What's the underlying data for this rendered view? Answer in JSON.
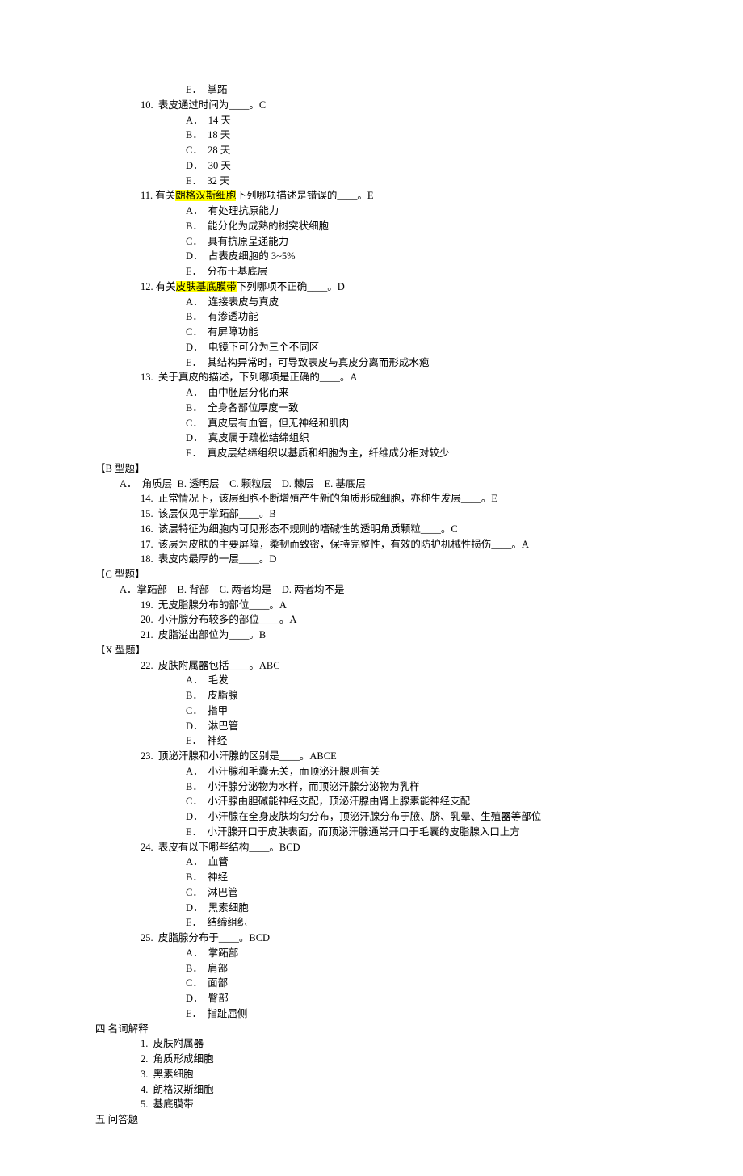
{
  "q9e": "E．  掌跖",
  "q10": "10.  表皮通过时间为____。C",
  "q10a": "A．  14 天",
  "q10b": "B．  18 天",
  "q10c": "C．  28 天",
  "q10d": "D．  30 天",
  "q10e": "E．  32 天",
  "q11_a": "11.  有关",
  "q11_hl": "朗格汉斯细胞",
  "q11_b": "下列哪项描述是错误的____。E",
  "q11a": "A．  有处理抗原能力",
  "q11b": "B．  能分化为成熟的树突状细胞",
  "q11c": "C．  具有抗原呈递能力",
  "q11d": "D．  占表皮细胞的 3~5%",
  "q11e": "E．  分布于基底层",
  "q12_a": "12.  有关",
  "q12_hl": "皮肤基底膜带",
  "q12_b": "下列哪项不正确____。D",
  "q12a": "A．  连接表皮与真皮",
  "q12b": "B．  有渗透功能",
  "q12c": "C．  有屏障功能",
  "q12d": "D．  电镜下可分为三个不同区",
  "q12e": "E．  其结构异常时，可导致表皮与真皮分离而形成水疱",
  "q13": "13.  关于真皮的描述，下列哪项是正确的____。A",
  "q13a": "A．  由中胚层分化而来",
  "q13b": "B．  全身各部位厚度一致",
  "q13c": "C．  真皮层有血管，但无神经和肌肉",
  "q13d": "D．  真皮属于疏松结缔组织",
  "q13e": "E．  真皮层结缔组织以基质和细胞为主，纤维成分相对较少",
  "secB": "【B 型题】",
  "bOpts": "A．  角质层  B. 透明层    C. 颗粒层    D. 棘层    E. 基底层",
  "q14": "14.  正常情况下，该层细胞不断增殖产生新的角质形成细胞，亦称生发层____。E",
  "q15": "15.  该层仅见于掌跖部____。B",
  "q16": "16.  该层特征为细胞内可见形态不规则的嗜碱性的透明角质颗粒____。C",
  "q17": "17.  该层为皮肤的主要屏障，柔韧而致密，保持完整性，有效的防护机械性损伤____。A",
  "q18": "18.  表皮内最厚的一层____。D",
  "secC": "【C 型题】",
  "cOpts": "A．掌跖部    B. 背部    C. 两者均是    D. 两者均不是",
  "q19": "19.  无皮脂腺分布的部位____。A",
  "q20": "20.  小汗腺分布较多的部位____。A",
  "q21": "21.  皮脂溢出部位为____。B",
  "secX": "【X 型题】",
  "q22": "22.  皮肤附属器包括____。ABC",
  "q22a": "A．  毛发",
  "q22b": "B．  皮脂腺",
  "q22c": "C．  指甲",
  "q22d": "D．  淋巴管",
  "q22e": "E．  神经",
  "q23": "23.  顶泌汗腺和小汗腺的区别是____。ABCE",
  "q23a": "A．  小汗腺和毛囊无关，而顶泌汗腺则有关",
  "q23b": "B．  小汗腺分泌物为水样，而顶泌汗腺分泌物为乳样",
  "q23c": "C．  小汗腺由胆碱能神经支配，顶泌汗腺由肾上腺素能神经支配",
  "q23d": "D．  小汗腺在全身皮肤均匀分布，顶泌汗腺分布于腋、脐、乳晕、生殖器等部位",
  "q23e": "E．  小汗腺开口于皮肤表面，而顶泌汗腺通常开口于毛囊的皮脂腺入口上方",
  "q24": "24.  表皮有以下哪些结构____。BCD",
  "q24a": "A．  血管",
  "q24b": "B．  神经",
  "q24c": "C．  淋巴管",
  "q24d": "D．  黑素细胞",
  "q24e": "E．  结缔组织",
  "q25": "25.  皮脂腺分布于____。BCD",
  "q25a": "A．  掌跖部",
  "q25b": "B．  肩部",
  "q25c": "C．  面部",
  "q25d": "D．  臀部",
  "q25e": "E．  指趾屈侧",
  "sec4": "四 名词解释",
  "t1": "1.  皮肤附属器",
  "t2": "2.  角质形成细胞",
  "t3": "3.  黑素细胞",
  "t4": "4.  朗格汉斯细胞",
  "t5": "5.  基底膜带",
  "sec5": "五 问答题"
}
